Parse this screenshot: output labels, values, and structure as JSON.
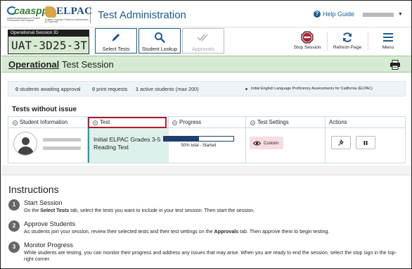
{
  "header": {
    "caaspp_logo_text": "caaspp",
    "caaspp_logo_sub": "California Assessment of Student Performance and Progress",
    "elpac_logo_text": "ELPAC",
    "elpac_logo_sub": "English Language Proficiency Assessments for California",
    "app_title": "Test Administration",
    "help_label": "Help Guide"
  },
  "session": {
    "label": "Operational Session ID",
    "id": "UAT-3D25-3T"
  },
  "toolbar": {
    "select_tests": "Select Tests",
    "student_lookup": "Student Lookup",
    "approvals": "Approvals",
    "stop_session": "Stop Session",
    "refresh_page": "Refresh Page",
    "menu": "Menu"
  },
  "banner": {
    "bold": "Operational",
    "rest": "Test Session"
  },
  "stats": {
    "awaiting_count": "0",
    "awaiting_label": "students awaiting approval",
    "print_count": "0",
    "print_label": "print requests",
    "active_count": "1",
    "active_label": "active students (max 200)",
    "assessment": "Initial English Language Proficiency Assessments for California (ELPAC)"
  },
  "tests": {
    "section_title": "Tests without issue",
    "columns": [
      "Student Information",
      "Test",
      "Progress",
      "Test Settings",
      "Actions"
    ],
    "row": {
      "test_name": "Initial ELPAC Grades 3-5 Reading Test",
      "progress_text": "50% total  -  Started",
      "progress_fraction": 0.5,
      "settings": "Custom"
    }
  },
  "instructions": {
    "title": "Instructions",
    "steps": [
      {
        "num": "1",
        "heading": "Start Session",
        "pre": "On the ",
        "bold": "Select Tests",
        "post": " tab, select the tests you want to include in your test session. Then start the session."
      },
      {
        "num": "2",
        "heading": "Approve Students",
        "pre": "As students join your session, review their selected tests and their test settings on the ",
        "bold": "Approvals",
        "post": " tab. Then approve them to begin testing."
      },
      {
        "num": "3",
        "heading": "Monitor Progress",
        "text": "While students are testing, you can monitor their progress and address any issues that may arise. When you are ready to end the session, select the stop sign in the top-right corner."
      }
    ]
  },
  "colors": {
    "brand_blue": "#1e5a8c",
    "banner_green": "#d7ead3",
    "highlight_red": "#b21f2d",
    "progress_fill": "#1e3f6e",
    "settings_pink": "#f7dddf"
  }
}
